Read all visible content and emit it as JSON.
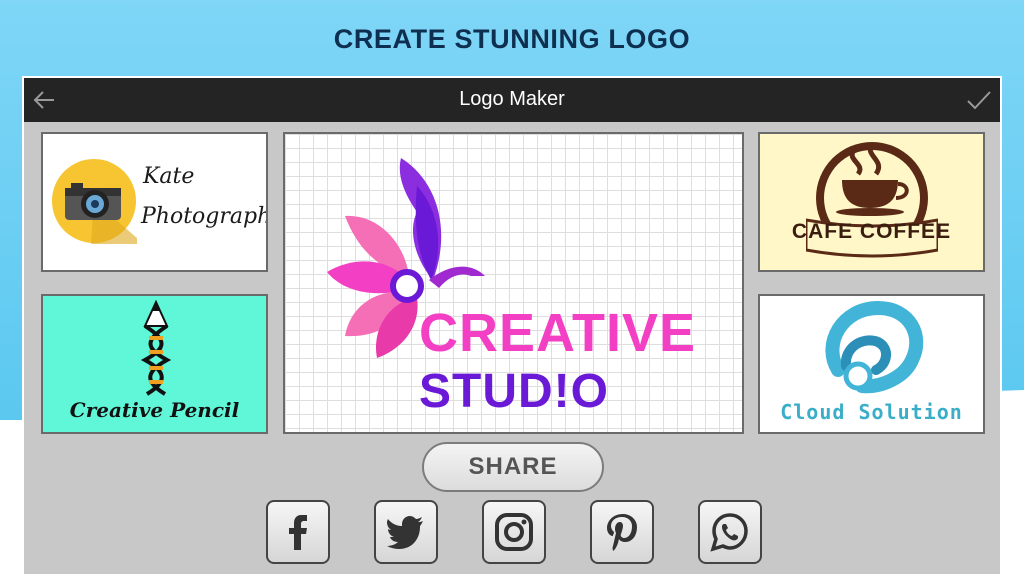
{
  "headline": "CREATE STUNNING LOGO",
  "app": {
    "title": "Logo Maker"
  },
  "logos": {
    "kate": {
      "line1": "Kate",
      "line2": "Photography"
    },
    "pencil": {
      "text": "Creative Pencil"
    },
    "center": {
      "line1": "CREATIVE",
      "line2": "STUD!O"
    },
    "cafe": {
      "text": "CAFE COFFEE"
    },
    "cloud": {
      "text": "Cloud Solution"
    }
  },
  "share": {
    "label": "SHARE"
  },
  "social_icons": [
    "facebook-icon",
    "twitter-icon",
    "instagram-icon",
    "pinterest-icon",
    "whatsapp-icon"
  ],
  "colors": {
    "background_blue": "#5bc8f0",
    "headline": "#0e2f4f",
    "titlebar": "#242424",
    "panel": "#c8c8c8",
    "creative_pink": "#f23fc4",
    "studio_purple": "#6a19d6",
    "pencil_bg": "#5ff7d8",
    "cafe_bg": "#fff7c8",
    "cloud_blue": "#3aaec8"
  }
}
